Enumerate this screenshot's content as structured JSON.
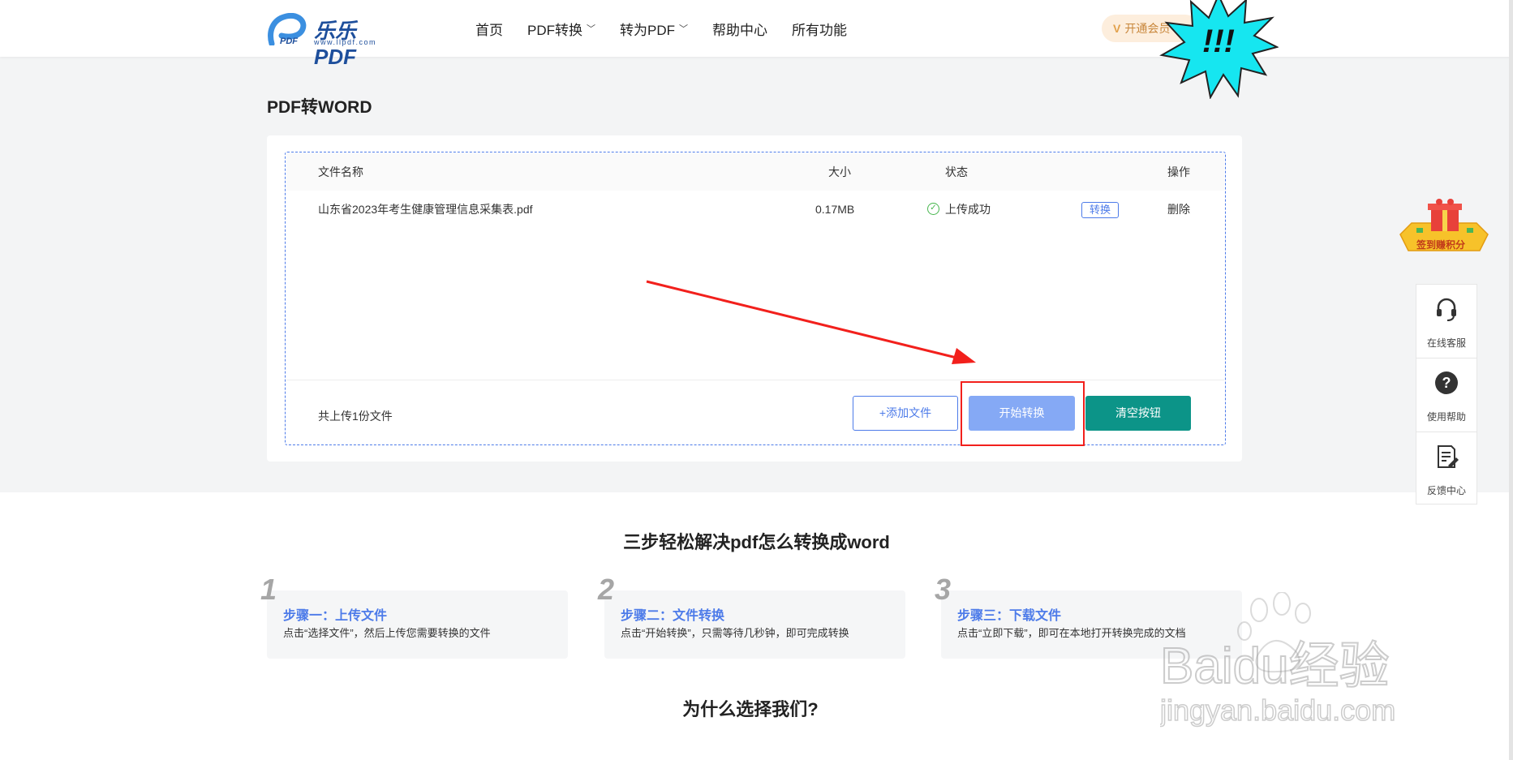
{
  "header": {
    "logo_text": "乐乐PDF",
    "logo_sub": "www.llpdf.com",
    "nav": [
      {
        "label": "首页",
        "has_dropdown": false
      },
      {
        "label": "PDF转换",
        "has_dropdown": true
      },
      {
        "label": "转为PDF",
        "has_dropdown": true
      },
      {
        "label": "帮助中心",
        "has_dropdown": false
      },
      {
        "label": "所有功能",
        "has_dropdown": false
      }
    ],
    "vip_label": "开通会员",
    "burst_text": "!!!"
  },
  "main": {
    "title": "PDF转WORD",
    "table": {
      "headers": {
        "name": "文件名称",
        "size": "大小",
        "status": "状态",
        "op": "操作"
      },
      "rows": [
        {
          "name": "山东省2023年考生健康管理信息采集表.pdf",
          "size": "0.17MB",
          "status": "上传成功",
          "convert": "转换",
          "delete": "删除"
        }
      ]
    },
    "file_count": "共上传1份文件",
    "buttons": {
      "add": "+添加文件",
      "start": "开始转换",
      "clear": "清空按钮"
    }
  },
  "steps": {
    "title": "三步轻松解决pdf怎么转换成word",
    "items": [
      {
        "num": "1",
        "title": "步骤一：上传文件",
        "desc": "点击“选择文件”，然后上传您需要转换的文件"
      },
      {
        "num": "2",
        "title": "步骤二：文件转换",
        "desc": "点击“开始转换”，只需等待几秒钟，即可完成转换"
      },
      {
        "num": "3",
        "title": "步骤三：下载文件",
        "desc": "点击“立即下载”，即可在本地打开转换完成的文档"
      }
    ]
  },
  "why_title": "为什么选择我们?",
  "side": {
    "gift_label": "签到赚积分",
    "items": [
      {
        "label": "在线客服",
        "icon": "headset-icon"
      },
      {
        "label": "使用帮助",
        "icon": "question-icon"
      },
      {
        "label": "反馈中心",
        "icon": "feedback-icon"
      }
    ]
  },
  "watermark": {
    "brand": "Baidu经验",
    "url": "jingyan.baidu.com"
  },
  "colors": {
    "accent": "#4d7be9",
    "start_button": "#85a9f5",
    "clear_button": "#0c9488",
    "annotation": "#f2201c"
  }
}
